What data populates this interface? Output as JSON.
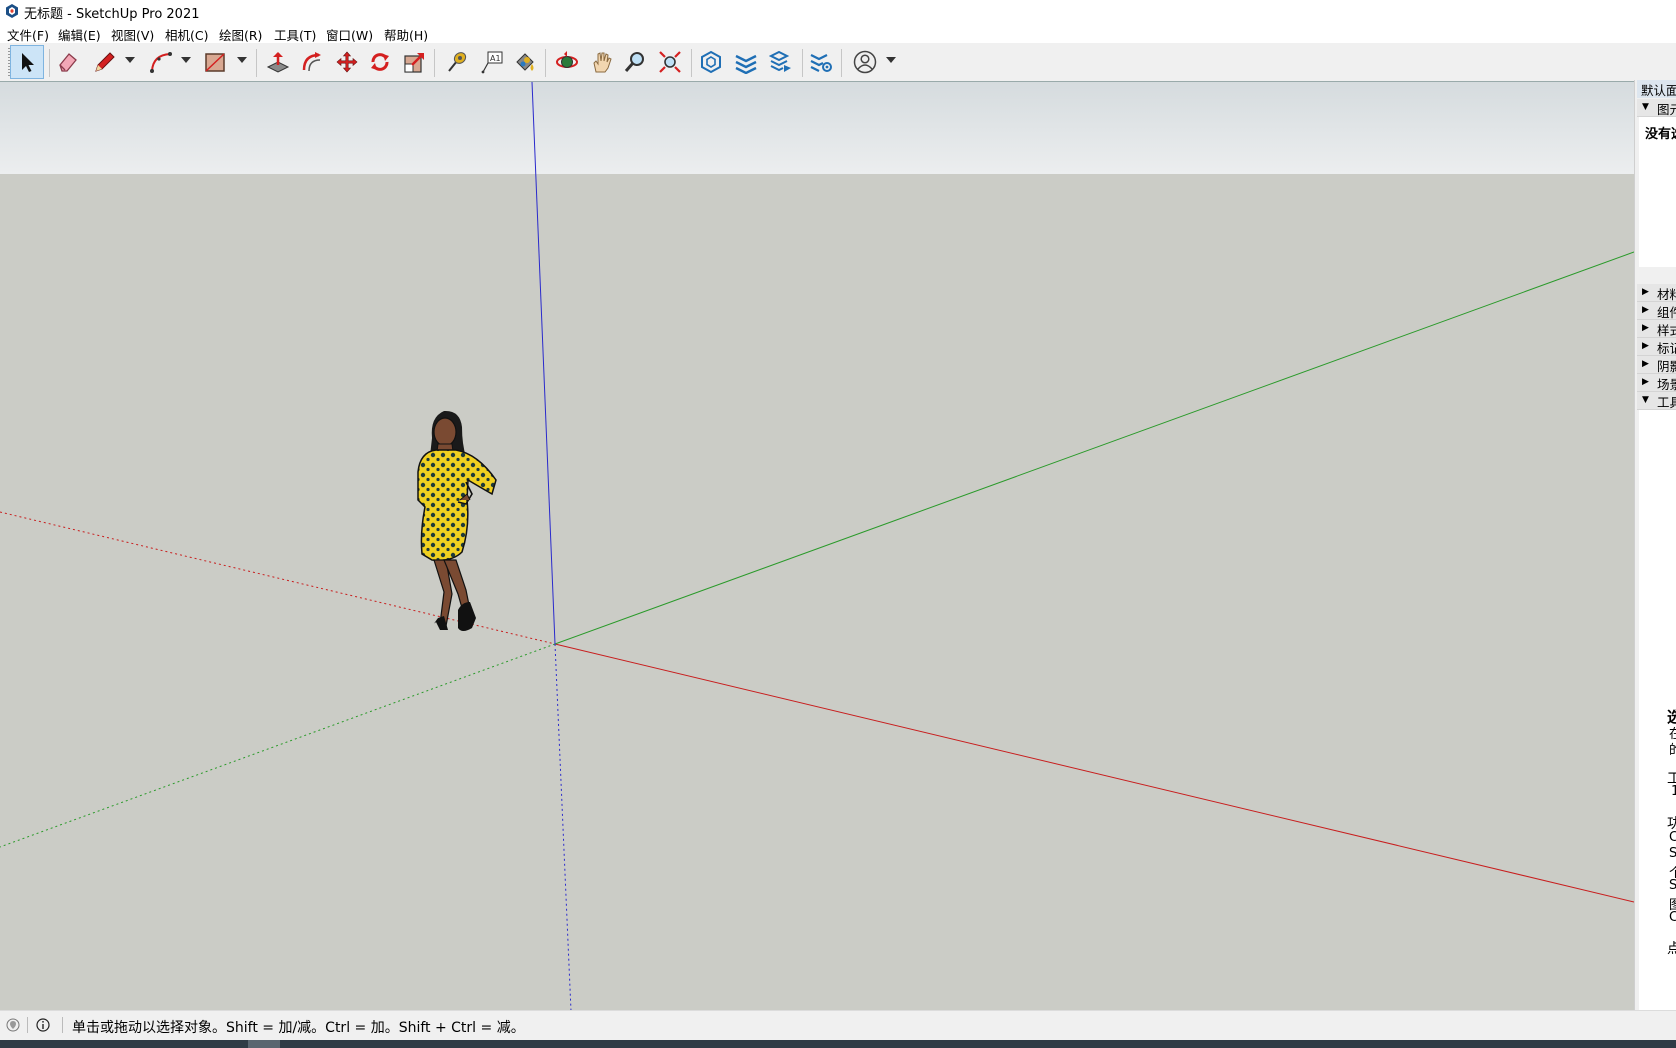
{
  "window": {
    "title": "无标题 - SketchUp Pro 2021",
    "app_icon": "sketchup-logo-icon"
  },
  "menu": {
    "items": [
      {
        "label": "文件(F)"
      },
      {
        "label": "编辑(E)"
      },
      {
        "label": "视图(V)"
      },
      {
        "label": "相机(C)"
      },
      {
        "label": "绘图(R)"
      },
      {
        "label": "工具(T)"
      },
      {
        "label": "窗口(W)"
      },
      {
        "label": "帮助(H)"
      }
    ]
  },
  "toolbar": {
    "tools": [
      {
        "name": "select-tool",
        "icon": "arrow-cursor-icon",
        "active": true
      },
      {
        "name": "eraser-tool",
        "icon": "eraser-icon"
      },
      {
        "name": "line-tool",
        "icon": "pencil-icon",
        "dropdown": true
      },
      {
        "name": "arc-tool",
        "icon": "arc-icon",
        "dropdown": true
      },
      {
        "name": "rectangle-tool",
        "icon": "rectangle-icon",
        "dropdown": true
      },
      {
        "name": "push-pull-tool",
        "icon": "push-pull-icon"
      },
      {
        "name": "offset-tool",
        "icon": "offset-icon"
      },
      {
        "name": "move-tool",
        "icon": "move-icon"
      },
      {
        "name": "rotate-tool",
        "icon": "rotate-icon"
      },
      {
        "name": "scale-tool",
        "icon": "scale-icon"
      },
      {
        "name": "tape-measure-tool",
        "icon": "tape-measure-icon"
      },
      {
        "name": "text-tool",
        "icon": "text-label-icon"
      },
      {
        "name": "paint-bucket-tool",
        "icon": "paint-bucket-icon"
      },
      {
        "name": "orbit-tool",
        "icon": "orbit-icon"
      },
      {
        "name": "pan-tool",
        "icon": "hand-icon"
      },
      {
        "name": "zoom-tool",
        "icon": "magnifier-icon"
      },
      {
        "name": "zoom-extents-tool",
        "icon": "zoom-extents-icon"
      },
      {
        "name": "3d-warehouse",
        "icon": "warehouse-icon"
      },
      {
        "name": "extension-warehouse",
        "icon": "extension-warehouse-icon"
      },
      {
        "name": "layout-send",
        "icon": "send-to-layout-icon"
      },
      {
        "name": "extension-manager",
        "icon": "extension-manager-icon"
      },
      {
        "name": "account-menu",
        "icon": "user-avatar-icon",
        "dropdown": true
      }
    ],
    "colors": {
      "red": "#d42020",
      "blue": "#1f6fb5",
      "gold": "#e0b020"
    }
  },
  "viewport": {
    "colors": {
      "sky": "#e4e8ea",
      "ground": "#cbccc6",
      "red_axis": "#c81e1e",
      "green_axis": "#2a9a2a",
      "blue_axis": "#2a2acc"
    }
  },
  "tray": {
    "header": "默认面板",
    "panels": [
      {
        "label": "图元信息",
        "expanded": true
      },
      {
        "label": "材料",
        "expanded": false
      },
      {
        "label": "组件",
        "expanded": false
      },
      {
        "label": "样式",
        "expanded": false
      },
      {
        "label": "标记",
        "expanded": false
      },
      {
        "label": "阴影",
        "expanded": false
      },
      {
        "label": "场景",
        "expanded": false
      },
      {
        "label": "工具向导",
        "expanded": true
      }
    ],
    "entity_info_text": "没有选择",
    "instructor_lines": [
      "选",
      "在",
      "的",
      "工",
      "1",
      "功",
      "C",
      "S",
      "个",
      "S",
      "图",
      "C",
      "点"
    ]
  },
  "status": {
    "geo_icon": "geo-location-icon",
    "info_icon": "info-icon",
    "text": "单击或拖动以选择对象。Shift = 加/减。Ctrl = 加。Shift + Ctrl = 减。"
  }
}
